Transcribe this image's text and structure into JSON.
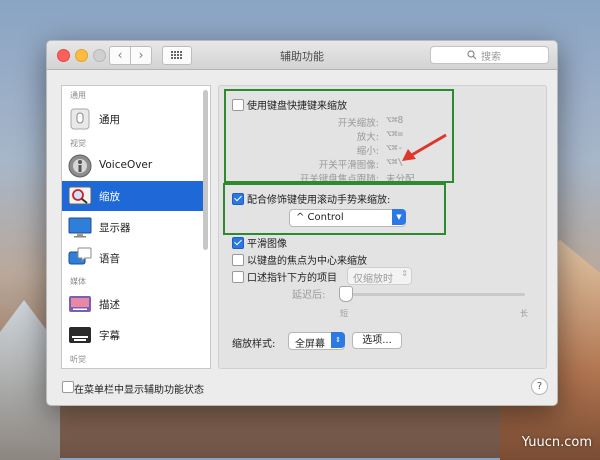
{
  "window": {
    "title": "辅助功能",
    "search_placeholder": "搜索"
  },
  "sidebar": {
    "sections": {
      "general": "通用",
      "vision": "视觉",
      "media": "媒体",
      "hearing": "听觉"
    },
    "items": [
      {
        "label": "通用",
        "icon": "general-icon"
      },
      {
        "label": "VoiceOver",
        "icon": "voiceover-icon"
      },
      {
        "label": "缩放",
        "icon": "zoom-icon",
        "selected": true
      },
      {
        "label": "显示器",
        "icon": "display-icon"
      },
      {
        "label": "语音",
        "icon": "speech-icon"
      },
      {
        "label": "描述",
        "icon": "descriptions-icon"
      },
      {
        "label": "字幕",
        "icon": "captions-icon"
      }
    ]
  },
  "panel": {
    "keyboard_shortcuts": {
      "label": "使用键盘快捷键来缩放",
      "checked": false
    },
    "shortcuts": [
      {
        "name": "开关缩放:",
        "key": "⌥⌘8"
      },
      {
        "name": "放大:",
        "key": "⌥⌘="
      },
      {
        "name": "缩小:",
        "key": "⌥⌘-"
      },
      {
        "name": "开关平滑图像:",
        "key": "⌥⌘\\"
      },
      {
        "name": "开关键盘焦点跟随:",
        "key": "未分配"
      }
    ],
    "scroll_gesture": {
      "label": "配合修饰键使用滚动手势来缩放:",
      "checked": true,
      "modifier": "^ Control"
    },
    "smooth_images": {
      "label": "平滑图像",
      "checked": true
    },
    "follow_focus": {
      "label": "以键盘的焦点为中心来缩放",
      "checked": false
    },
    "speak_pointer": {
      "label": "口述指针下方的项目",
      "checked": false,
      "option": "仅缩放时"
    },
    "delay": {
      "label": "延迟后:",
      "short": "短",
      "long": "长",
      "value": 0
    },
    "zoom_style": {
      "label": "缩放样式:",
      "value": "全屏幕",
      "options_button": "选项..."
    }
  },
  "footer": {
    "show_status_label": "在菜单栏中显示辅助功能状态",
    "checked": false,
    "help": "?"
  },
  "watermark": "Yuucn.com",
  "colors": {
    "accent": "#1e68d8",
    "annotation_green": "#2e8a2e",
    "annotation_red": "#e0352b"
  }
}
